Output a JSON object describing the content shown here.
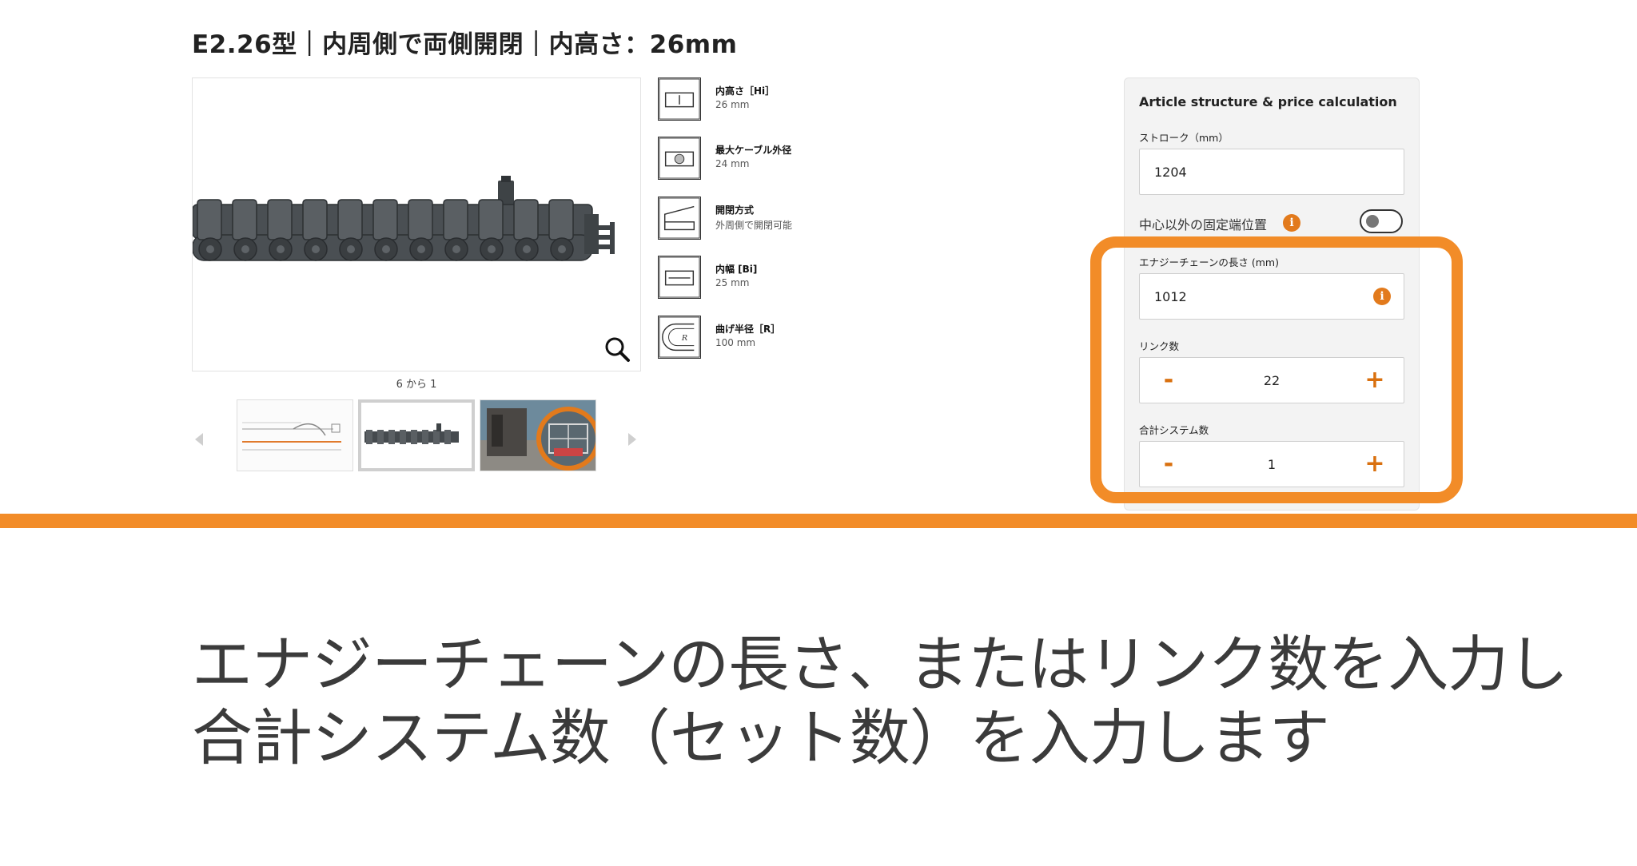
{
  "title": "E2.26型｜内周側で両側開閉｜内高さ：26mm",
  "image_counter": "6 から 1",
  "specs": [
    {
      "label": "内高さ［Hi］",
      "value": "26 mm",
      "icon": "inner-height-icon"
    },
    {
      "label": "最大ケーブル外径",
      "value": "24 mm",
      "icon": "cable-diameter-icon"
    },
    {
      "label": "開閉方式",
      "value": "外周側で開閉可能",
      "icon": "opening-type-icon"
    },
    {
      "label": "内幅 [Bi]",
      "value": "25 mm",
      "icon": "inner-width-icon"
    },
    {
      "label": "曲げ半径［R］",
      "value": "100 mm",
      "icon": "bend-radius-icon"
    }
  ],
  "panel": {
    "title": "Article structure & price calculation",
    "stroke_label": "ストローク（mm）",
    "stroke_value": "1204",
    "toggle_label": "中心以外の固定端位置",
    "chain_length_label": "エナジーチェーンの長さ (mm)",
    "chain_length_value": "1012",
    "links_label": "リンク数",
    "links_value": "22",
    "systems_label": "合計システム数",
    "systems_value": "1",
    "minus": "-",
    "plus": "+",
    "info": "i"
  },
  "caption": {
    "line1": "エナジーチェーンの長さ、またはリンク数を入力し",
    "line2": "合計システム数（セット数）を入力します"
  },
  "colors": {
    "accent": "#f28c28",
    "stepper": "#d9700f",
    "info": "#e27a1c"
  }
}
